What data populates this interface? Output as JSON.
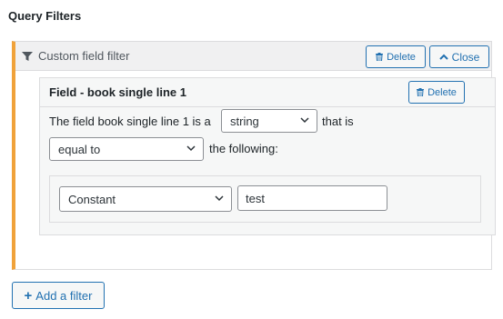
{
  "section": {
    "title": "Query Filters"
  },
  "filter": {
    "title": "Custom field filter",
    "delete_label": "Delete",
    "close_label": "Close",
    "field": {
      "title": "Field - book single line 1",
      "delete_label": "Delete",
      "sentence_prefix": "The field book single line 1 is a",
      "type_value": "string",
      "sentence_middle": "that is",
      "compare_value": "equal to",
      "sentence_suffix": "the following:",
      "value_type": "Constant",
      "value_input": "test"
    }
  },
  "add_filter_label": "Add a filter",
  "colors": {
    "accent": "#2271b1",
    "highlight_border": "#f0a23a"
  }
}
